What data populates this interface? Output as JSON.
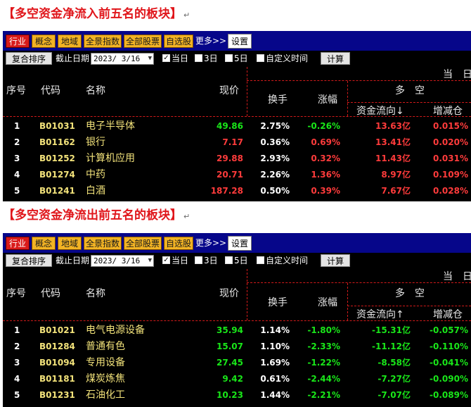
{
  "sections": [
    {
      "title": "【多空资金净流入前五名的板块】",
      "para_mark": "↵",
      "toolbar": {
        "tabs": [
          "行业",
          "概念",
          "地域",
          "全景指数",
          "全部股票",
          "自选股"
        ],
        "more": "更多>>",
        "settings": "设置"
      },
      "filter": {
        "sort_button": "复合排序",
        "date_label": "截止日期",
        "date_value": "2023/ 3/16",
        "options": [
          {
            "label": "当日",
            "checked": true
          },
          {
            "label": "3日",
            "checked": false
          },
          {
            "label": "5日",
            "checked": false
          },
          {
            "label": "自定义时间",
            "checked": false
          }
        ],
        "calc_button": "计算"
      },
      "headers": {
        "top_right": "当　日",
        "index": "序号",
        "code": "代码",
        "name": "名称",
        "price": "现价",
        "turnover": "换手",
        "change": "涨幅",
        "group": "多　空",
        "flow": "资金流向↓",
        "incdec": "增减仓"
      },
      "rows": [
        {
          "index": "1",
          "code": "B01031",
          "name": "电子半导体",
          "price": "49.86",
          "turnover": "2.75%",
          "change": "-0.26%",
          "flow": "13.63亿",
          "incdec": "0.015%"
        },
        {
          "index": "2",
          "code": "B01162",
          "name": "银行",
          "price": "7.17",
          "turnover": "0.36%",
          "change": "0.69%",
          "flow": "13.41亿",
          "incdec": "0.020%"
        },
        {
          "index": "3",
          "code": "B01252",
          "name": "计算机应用",
          "price": "29.88",
          "turnover": "2.93%",
          "change": "0.32%",
          "flow": "11.43亿",
          "incdec": "0.031%"
        },
        {
          "index": "4",
          "code": "B01274",
          "name": "中药",
          "price": "20.71",
          "turnover": "2.26%",
          "change": "1.36%",
          "flow": "8.97亿",
          "incdec": "0.109%"
        },
        {
          "index": "5",
          "code": "B01241",
          "name": "白酒",
          "price": "187.28",
          "turnover": "0.50%",
          "change": "0.39%",
          "flow": "7.67亿",
          "incdec": "0.028%"
        }
      ]
    },
    {
      "title": "【多空资金净流出前五名的板块】",
      "para_mark": "↵",
      "toolbar": {
        "tabs": [
          "行业",
          "概念",
          "地域",
          "全景指数",
          "全部股票",
          "自选股"
        ],
        "more": "更多>>",
        "settings": "设置"
      },
      "filter": {
        "sort_button": "复合排序",
        "date_label": "截止日期",
        "date_value": "2023/ 3/16",
        "options": [
          {
            "label": "当日",
            "checked": true
          },
          {
            "label": "3日",
            "checked": false
          },
          {
            "label": "5日",
            "checked": false
          },
          {
            "label": "自定义时间",
            "checked": false
          }
        ],
        "calc_button": "计算"
      },
      "headers": {
        "top_right": "当　日",
        "index": "序号",
        "code": "代码",
        "name": "名称",
        "price": "现价",
        "turnover": "换手",
        "change": "涨幅",
        "group": "多　空",
        "flow": "资金流向↑",
        "incdec": "增减仓"
      },
      "rows": [
        {
          "index": "1",
          "code": "B01021",
          "name": "电气电源设备",
          "price": "35.94",
          "turnover": "1.14%",
          "change": "-1.80%",
          "flow": "-15.31亿",
          "incdec": "-0.057%"
        },
        {
          "index": "2",
          "code": "B01284",
          "name": "普通有色",
          "price": "15.07",
          "turnover": "1.10%",
          "change": "-2.33%",
          "flow": "-11.12亿",
          "incdec": "-0.110%"
        },
        {
          "index": "3",
          "code": "B01094",
          "name": "专用设备",
          "price": "27.45",
          "turnover": "1.69%",
          "change": "-1.22%",
          "flow": "-8.58亿",
          "incdec": "-0.041%"
        },
        {
          "index": "4",
          "code": "B01181",
          "name": "煤炭炼焦",
          "price": "9.42",
          "turnover": "0.61%",
          "change": "-2.44%",
          "flow": "-7.27亿",
          "incdec": "-0.090%"
        },
        {
          "index": "5",
          "code": "B01231",
          "name": "石油化工",
          "price": "10.23",
          "turnover": "1.44%",
          "change": "-2.21%",
          "flow": "-7.07亿",
          "incdec": "-0.089%"
        }
      ]
    }
  ],
  "colors": {
    "positive": "#ff3b3b",
    "negative": "#19e619",
    "title_red": "#e0161b",
    "toolbar_blue": "#06068a",
    "tab_orange": "#f2b324",
    "tab_active": "#d91a1a"
  }
}
